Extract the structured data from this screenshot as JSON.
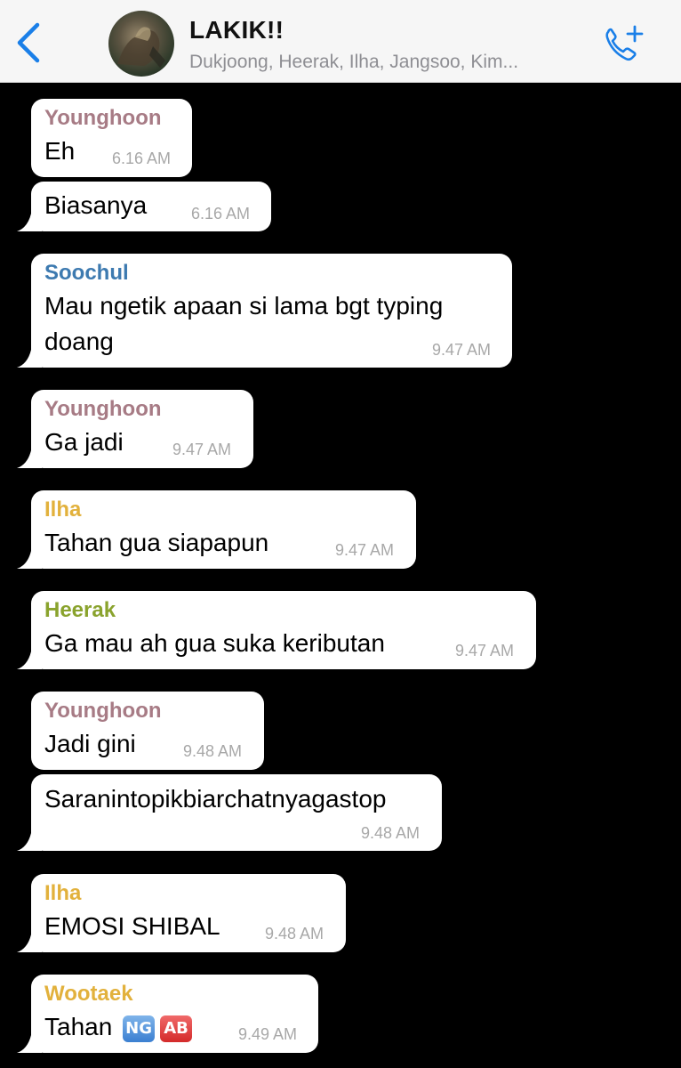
{
  "header": {
    "back_icon": "chevron-left-icon",
    "title": "LAKIK!!",
    "subtitle": "Dukjoong, Heerak, Ilha, Jangsoo, Kim...",
    "call_icon": "add-call-icon"
  },
  "colors": {
    "accent": "#1a7fe8",
    "younghoon": "#a77b85",
    "soochul": "#3d7ab0",
    "ilha": "#e2b13c",
    "heerak": "#8aa32d",
    "wootaek": "#e2b13c"
  },
  "messages": [
    {
      "sender": "Younghoon",
      "text": "Eh",
      "time": "6.16 AM"
    },
    {
      "text": "Biasanya",
      "time": "6.16 AM"
    },
    {
      "sender": "Soochul",
      "text_line1": "Mau ngetik apaan si lama bgt typing",
      "text_line2": "doang",
      "time": "9.47 AM"
    },
    {
      "sender": "Younghoon",
      "text": "Ga jadi",
      "time": "9.47 AM"
    },
    {
      "sender": "Ilha",
      "text": "Tahan gua siapapun",
      "time": "9.47 AM"
    },
    {
      "sender": "Heerak",
      "text": "Ga mau ah gua suka keributan",
      "time": "9.47 AM"
    },
    {
      "sender": "Younghoon",
      "text": "Jadi gini",
      "time": "9.48 AM"
    },
    {
      "text": "Saranintopikbiarchatnyagastop",
      "time": "9.48 AM"
    },
    {
      "sender": "Ilha",
      "text": "EMOSI SHIBAL",
      "time": "9.48 AM"
    },
    {
      "sender": "Wootaek",
      "text": "Tahan",
      "emoji1": "NG",
      "emoji2": "AB",
      "time": "9.49 AM"
    }
  ]
}
